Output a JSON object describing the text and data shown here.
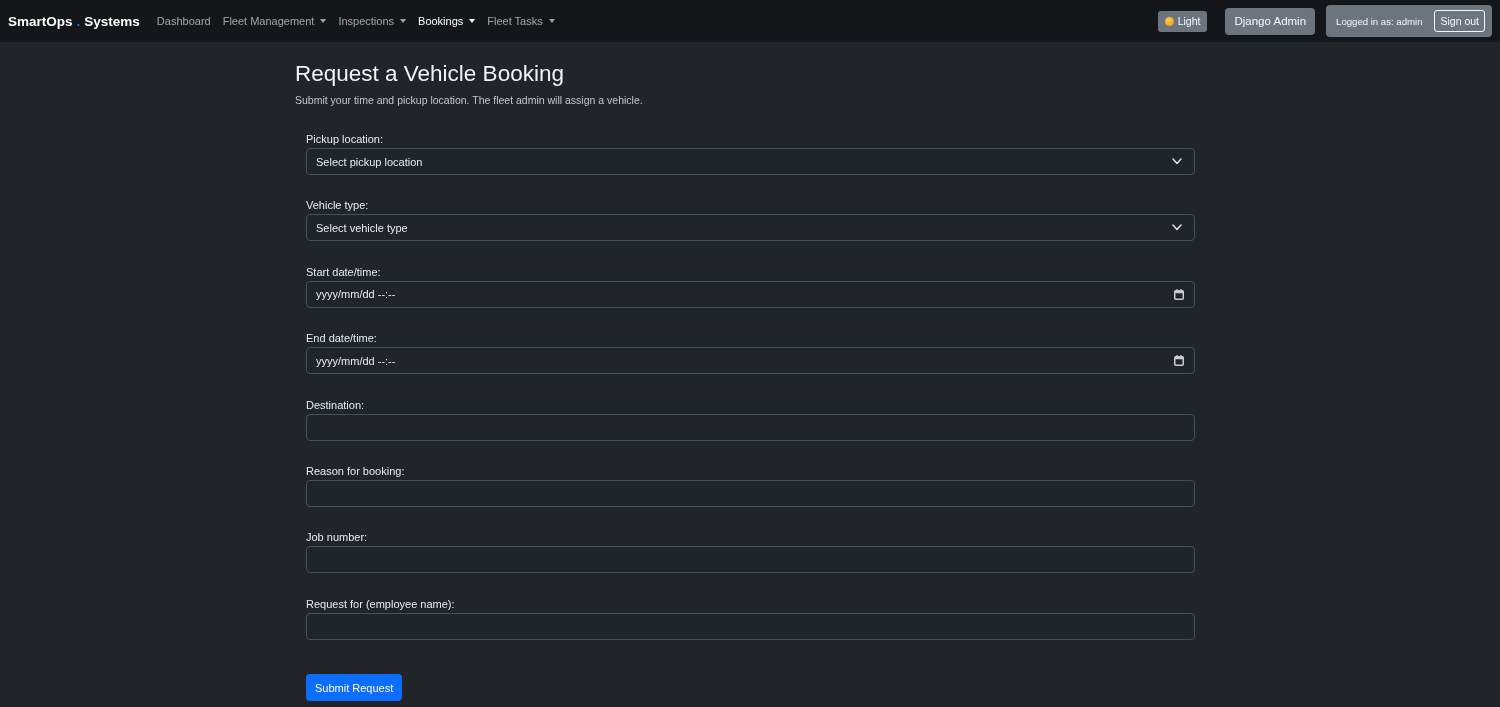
{
  "navbar": {
    "brand": {
      "name": "SmartOps",
      "separator": ".",
      "suffix": "Systems"
    },
    "links": [
      {
        "label": "Dashboard",
        "dropdown": false,
        "selected": false
      },
      {
        "label": "Fleet Management",
        "dropdown": true,
        "selected": false
      },
      {
        "label": "Inspections",
        "dropdown": true,
        "selected": false
      },
      {
        "label": "Bookings",
        "dropdown": true,
        "selected": true
      },
      {
        "label": "Fleet Tasks",
        "dropdown": true,
        "selected": false
      }
    ],
    "theme_button": "Light",
    "admin_button": "Django Admin",
    "user": {
      "text": "Logged in as: admin",
      "sign_out": "Sign out"
    }
  },
  "page": {
    "title": "Request a Vehicle Booking",
    "subtitle": "Submit your time and pickup location. The fleet admin will assign a vehicle."
  },
  "form": {
    "fields": [
      {
        "label": "Pickup location:",
        "kind": "select",
        "value": "Select pickup location"
      },
      {
        "label": "Vehicle type:",
        "kind": "select",
        "value": "Select vehicle type"
      },
      {
        "label": "Start date/time:",
        "kind": "datetime",
        "placeholder": "yyyy/mm/dd --:--"
      },
      {
        "label": "End date/time:",
        "kind": "datetime",
        "placeholder": "yyyy/mm/dd --:--"
      },
      {
        "label": "Destination:",
        "kind": "text"
      },
      {
        "label": "Reason for booking:",
        "kind": "text"
      },
      {
        "label": "Job number:",
        "kind": "text"
      },
      {
        "label": "Request for (employee name):",
        "kind": "text"
      }
    ],
    "submit": "Submit Request"
  }
}
